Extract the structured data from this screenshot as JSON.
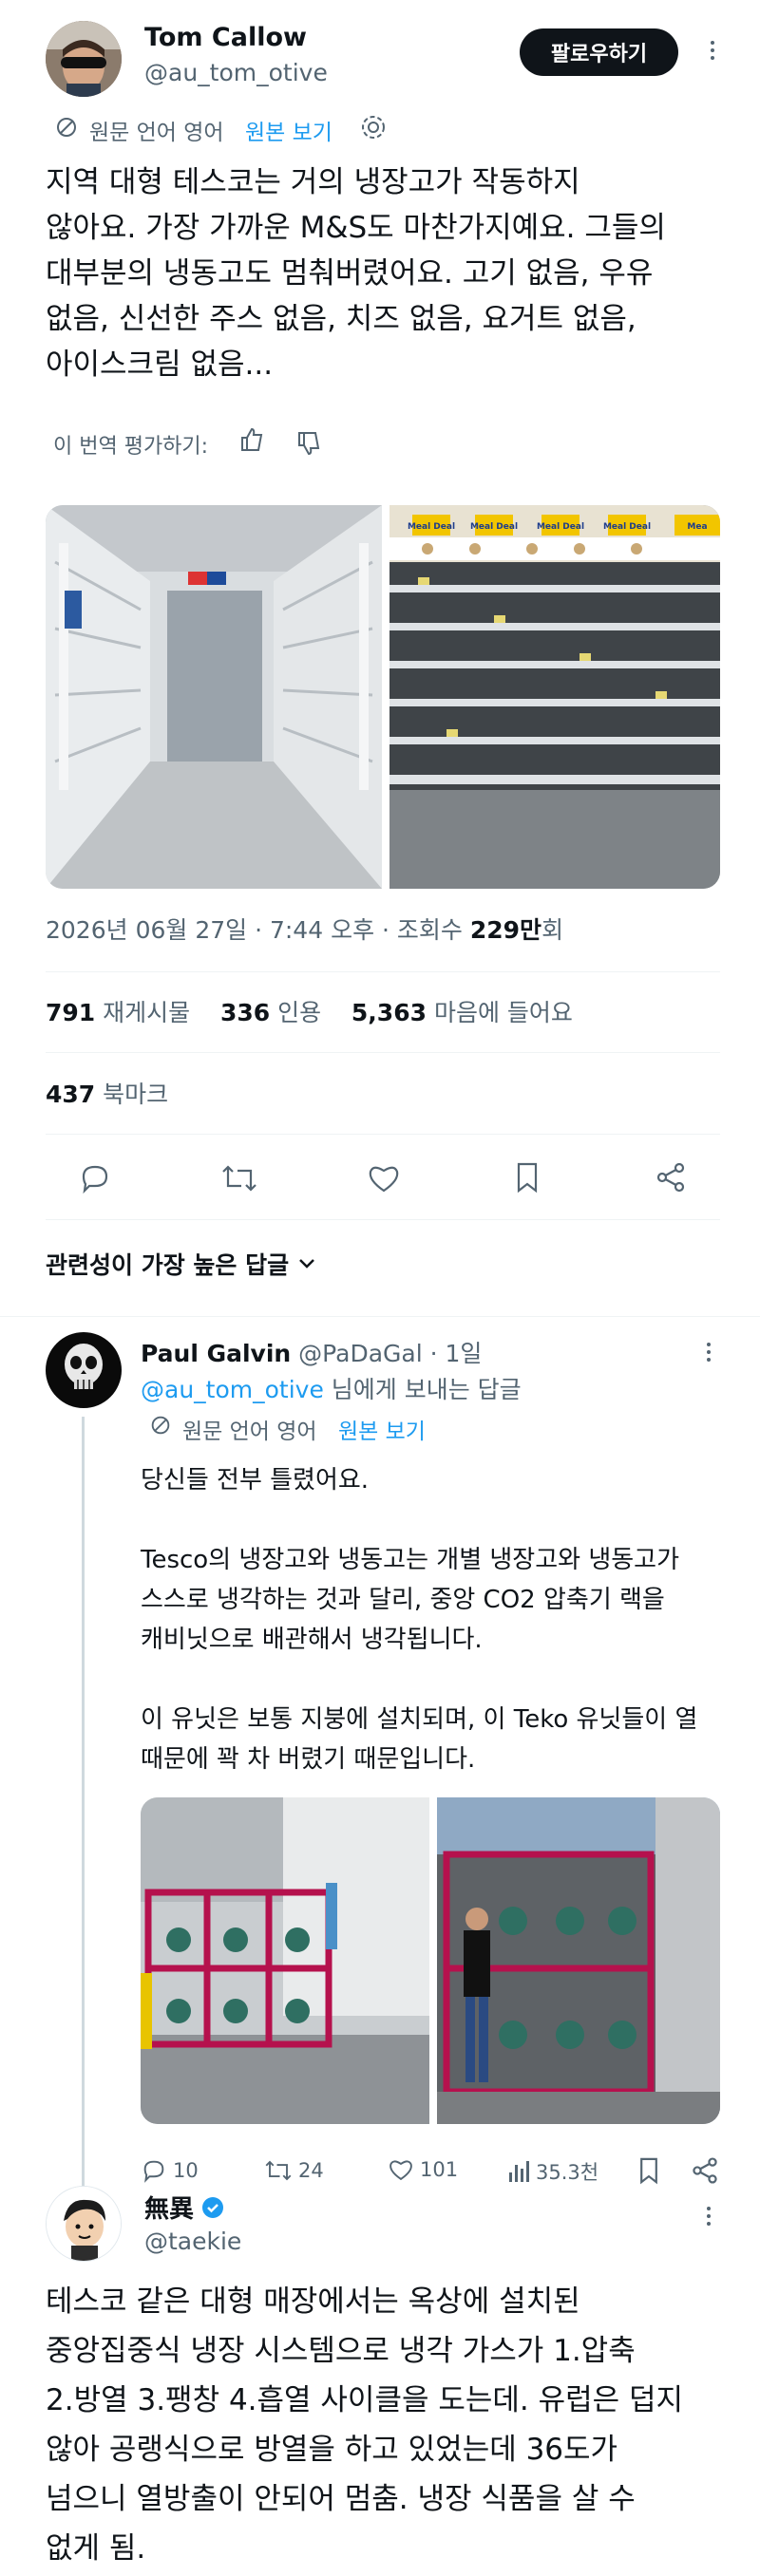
{
  "tweet": {
    "author_name": "Tom Callow",
    "author_handle": "@au_tom_otive",
    "follow_label": "팔로우하기",
    "translation_note": "원문 언어 영어",
    "show_original": "원본 보기",
    "text": "지역 대형 테스코는 거의 냉장고가 작동하지\n않아요. 가장 가까운 M&S도 마찬가지예요. 그들의\n대부분의 냉동고도 멈춰버렸어요. 고기 없음, 우유\n없음, 신선한 주스 없음, 치즈 없음, 요거트 없음,\n아이스크림 없음...",
    "rate_translation": "이 번역 평가하기:",
    "timestamp": "2026년 06월 27일 · 7:44 오후 · 조회수",
    "views_num": "229만",
    "views_suffix": "회",
    "retweets_num": "791",
    "retweets_label": "재게시물",
    "quotes_num": "336",
    "quotes_label": "인용",
    "likes_num": "5,363",
    "likes_label": "마음에 들어요",
    "bookmarks_num": "437",
    "bookmarks_label": "북마크",
    "shelf_signs": [
      "Meal Deal",
      "Meal Deal",
      "Meal Deal",
      "Meal Deal",
      "Mea"
    ]
  },
  "sort_label": "관련성이 가장 높은 답글",
  "reply": {
    "author_name": "Paul Galvin",
    "author_handle": "@PaDaGal",
    "time": "· 1일",
    "replying_to_handle": "@au_tom_otive",
    "replying_to_suffix": " 님에게 보내는 답글",
    "translation_note": "원문 언어 영어",
    "show_original": "원본 보기",
    "text": "당신들 전부 틀렸어요.\n\nTesco의 냉장고와 냉동고는 개별 냉장고와 냉동고가\n스스로 냉각하는 것과 달리, 중앙 CO2 압축기 랙을\n캐비닛으로 배관해서 냉각됩니다.\n\n이 유닛은 보통 지붕에 설치되며, 이 Teko 유닛들이 열\n때문에 꽉 차 버렸기 때문입니다.",
    "replies_count": "10",
    "retweets_count": "24",
    "likes_count": "101",
    "views_count": "35.3천"
  },
  "quote": {
    "author_name": "無異",
    "author_handle": "@taekie",
    "text": "테스코 같은 대형 매장에서는 옥상에 설치된\n중앙집중식 냉장 시스템으로 냉각 가스가 1.압축\n2.방열 3.팽창 4.흡열 사이클을 도는데. 유럽은 덥지\n않아 공랭식으로 방열을 하고 있었는데 36도가\n넘으니 열방출이 안되어 멈춤. 냉장 식품을 살 수\n없게 됨."
  },
  "colors": {
    "accent": "#1d9bf0",
    "text": "#0f1419",
    "muted": "#536471",
    "rack": "#b5114d",
    "verified": "#1d9bf0"
  }
}
